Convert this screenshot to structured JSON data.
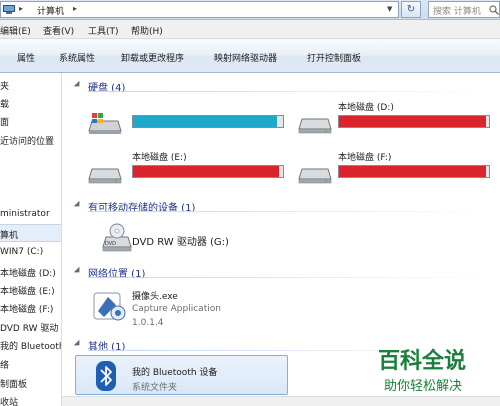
{
  "address_bar": {
    "path": "计算机",
    "search_placeholder": "搜索 计算机"
  },
  "menu": [
    "编辑(E)",
    "查看(V)",
    "工具(T)",
    "帮助(H)"
  ],
  "toolbar": [
    "属性",
    "系统属性",
    "卸载或更改程序",
    "映射网络驱动器",
    "打开控制面板"
  ],
  "nav": {
    "items": [
      "夹",
      "载",
      "面",
      "近访问的位置",
      "ministrator",
      "算机",
      "WIN7 (C:)",
      "本地磁盘 (D:)",
      "本地磁盘 (E:)",
      "本地磁盘 (F:)",
      "DVD RW 驱动",
      "我的 Bluetooth",
      "络",
      "制面板",
      "收站"
    ]
  },
  "groups": {
    "hard_disks": {
      "title": "硬盘 (4)",
      "drives": [
        {
          "label": "",
          "used_fraction": 0.96,
          "bar_color": "#1fa8c9"
        },
        {
          "label": "本地磁盘 (D:)",
          "used_fraction": 0.98,
          "bar_color": "#d9232d"
        },
        {
          "label": "本地磁盘 (E:)",
          "used_fraction": 0.97,
          "bar_color": "#d9232d"
        },
        {
          "label": "本地磁盘 (F:)",
          "used_fraction": 0.98,
          "bar_color": "#d9232d"
        }
      ]
    },
    "removable": {
      "title": "有可移动存储的设备 (1)",
      "dvd_label": "DVD RW 驱动器 (G:)"
    },
    "network": {
      "title": "网络位置 (1)",
      "item_name": "摄像头.exe",
      "item_desc": "Capture Application",
      "item_version": "1.0.1.4"
    },
    "other": {
      "title": "其他 (1)",
      "item_name": "我的 Bluetooth 设备",
      "item_type": "系统文件夹"
    }
  },
  "watermark": {
    "main": "百科全说",
    "sub": "助你轻松解决"
  }
}
